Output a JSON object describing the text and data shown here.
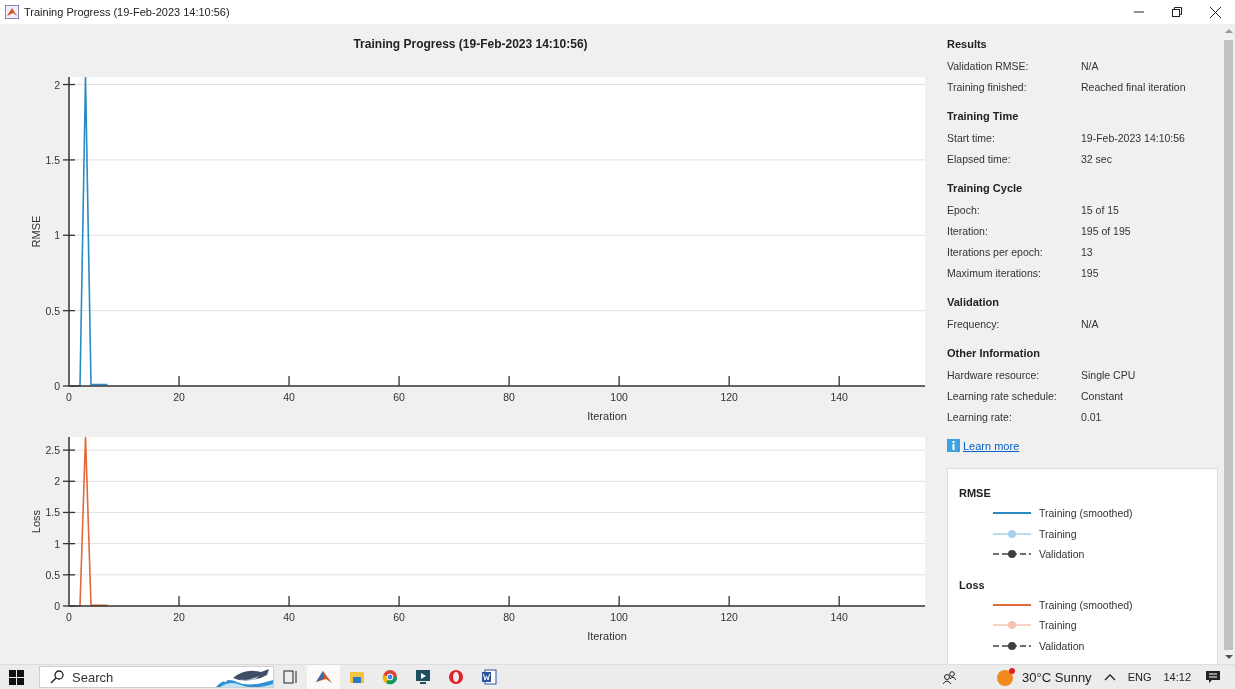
{
  "window": {
    "title": "Training Progress (19-Feb-2023 14:10:56)"
  },
  "figure_title": "Training Progress (19-Feb-2023 14:10:56)",
  "charts": [
    {
      "chart_data": {
        "type": "line",
        "xlabel": "Iteration",
        "ylabel": "RMSE",
        "x": [
          1,
          2,
          3,
          4,
          5,
          6,
          7
        ],
        "xlim": [
          0,
          155.6
        ],
        "ylim": [
          0,
          2.05
        ],
        "xticks": [
          0,
          20,
          40,
          60,
          80,
          100,
          120,
          140
        ],
        "yticks": [
          0,
          0.5,
          1,
          1.5,
          2
        ],
        "grid": true,
        "series": [
          {
            "color": "#2a8ac6",
            "values": [
              0,
              0,
              2.05,
              0.01,
              0.01,
              0.01,
              0.01
            ]
          }
        ]
      }
    },
    {
      "chart_data": {
        "type": "line",
        "xlabel": "Iteration",
        "ylabel": "Loss",
        "x": [
          1,
          2,
          3,
          4,
          5,
          6,
          7
        ],
        "xlim": [
          0,
          155.6
        ],
        "ylim": [
          0,
          2.71
        ],
        "xticks": [
          0,
          20,
          40,
          60,
          80,
          100,
          120,
          140
        ],
        "yticks": [
          0,
          0.5,
          1,
          1.5,
          2,
          2.5
        ],
        "grid": true,
        "series": [
          {
            "color": "#e2693a",
            "values": [
              0,
              0,
              2.71,
              0.01,
              0.01,
              0.01,
              0.01
            ]
          }
        ]
      }
    }
  ],
  "info_panel": {
    "sections": [
      {
        "heading": "Results",
        "rows": [
          {
            "label": "Validation RMSE:",
            "value": "N/A"
          },
          {
            "label": "Training finished:",
            "value": "Reached final iteration"
          }
        ]
      },
      {
        "heading": "Training Time",
        "rows": [
          {
            "label": "Start time:",
            "value": "19-Feb-2023 14:10:56"
          },
          {
            "label": "Elapsed time:",
            "value": "32 sec"
          }
        ]
      },
      {
        "heading": "Training Cycle",
        "rows": [
          {
            "label": "Epoch:",
            "value": "15 of 15"
          },
          {
            "label": "Iteration:",
            "value": "195 of 195"
          },
          {
            "label": "Iterations per epoch:",
            "value": "13"
          },
          {
            "label": "Maximum iterations:",
            "value": "195"
          }
        ]
      },
      {
        "heading": "Validation",
        "rows": [
          {
            "label": "Frequency:",
            "value": "N/A"
          }
        ]
      },
      {
        "heading": "Other Information",
        "rows": [
          {
            "label": "Hardware resource:",
            "value": "Single CPU"
          },
          {
            "label": "Learning rate schedule:",
            "value": "Constant"
          },
          {
            "label": "Learning rate:",
            "value": "0.01"
          }
        ]
      }
    ],
    "learn_more": "Learn more"
  },
  "legend": {
    "groups": [
      {
        "title": "RMSE",
        "entries": [
          {
            "label": "Training (smoothed)",
            "kind": "smoothed",
            "color": "#2a8ac6"
          },
          {
            "label": "Training",
            "kind": "raw",
            "color": "#a9d0ea"
          },
          {
            "label": "Validation",
            "kind": "validation",
            "color": "#404040"
          }
        ]
      },
      {
        "title": "Loss",
        "entries": [
          {
            "label": "Training (smoothed)",
            "kind": "smoothed",
            "color": "#e2693a"
          },
          {
            "label": "Training",
            "kind": "raw",
            "color": "#f5c3b0"
          },
          {
            "label": "Validation",
            "kind": "validation",
            "color": "#404040"
          }
        ]
      }
    ]
  },
  "taskbar": {
    "search_placeholder": "Search",
    "weather": "30°C Sunny",
    "language": "ENG",
    "time": "14:12"
  }
}
